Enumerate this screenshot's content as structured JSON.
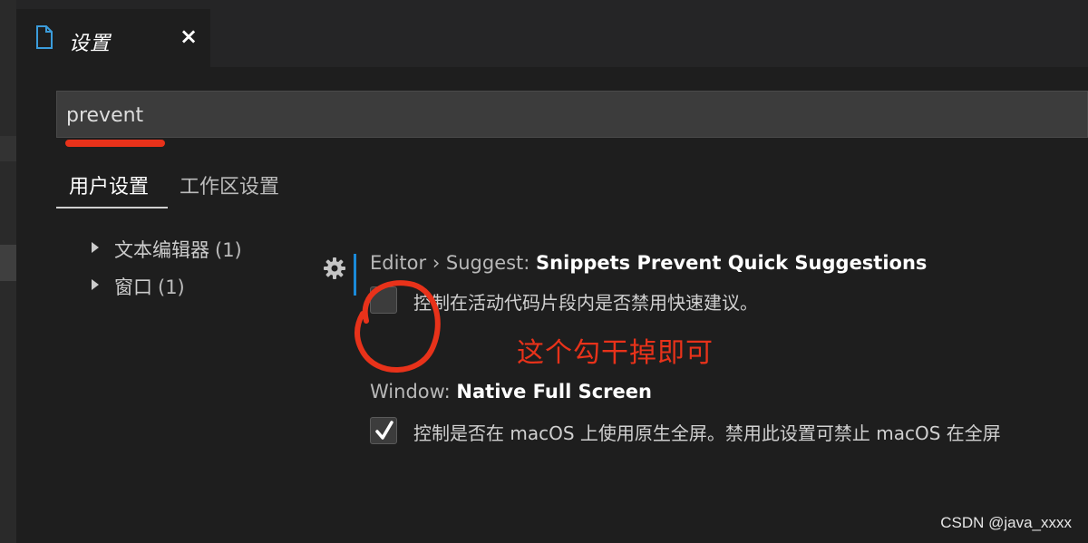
{
  "tab": {
    "title": "设置",
    "icon": "file-icon",
    "close": "×"
  },
  "search": {
    "value": "prevent"
  },
  "settings_tabs": [
    {
      "label": "用户设置",
      "active": true
    },
    {
      "label": "工作区设置",
      "active": false
    }
  ],
  "toc": [
    {
      "label": "文本编辑器",
      "count": "(1)"
    },
    {
      "label": "窗口",
      "count": "(1)"
    }
  ],
  "settings": [
    {
      "category": "Editor › Suggest: ",
      "name": "Snippets Prevent Quick Suggestions",
      "description": "控制在活动代码片段内是否禁用快速建议。",
      "checked": false
    },
    {
      "category": "Window: ",
      "name": "Native Full Screen",
      "description": "控制是否在 macOS 上使用原生全屏。禁用此设置可禁止 macOS 在全屏",
      "checked": true
    }
  ],
  "annotation": "这个勾干掉即可",
  "watermark": "CSDN @java_xxxx",
  "colors": {
    "annotation": "#e8321a",
    "accent": "#1a8ad9",
    "background": "#1e1e1e"
  }
}
